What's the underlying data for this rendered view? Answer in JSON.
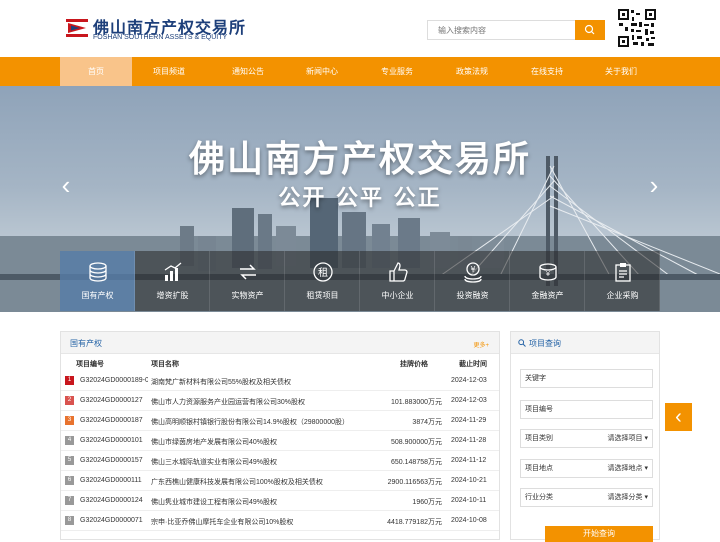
{
  "header": {
    "logo_cn": "佛山南方产权交易所",
    "logo_en": "FOSHAN SOUTHERN ASSETS & EQUITY",
    "search_placeholder": "输入搜索内容"
  },
  "nav": [
    "首页",
    "项目频道",
    "通知公告",
    "新闻中心",
    "专业服务",
    "政策法规",
    "在线支持",
    "关于我们"
  ],
  "banner": {
    "title": "佛山南方产权交易所",
    "subtitle": "公开 公平 公正"
  },
  "categories": [
    {
      "label": "国有产权",
      "icon": "coin-stack-icon"
    },
    {
      "label": "增资扩股",
      "icon": "bar-growth-icon"
    },
    {
      "label": "实物资产",
      "icon": "exchange-icon"
    },
    {
      "label": "租赁项目",
      "icon": "rent-icon"
    },
    {
      "label": "中小企业",
      "icon": "thumb-up-icon"
    },
    {
      "label": "投资融资",
      "icon": "yen-coins-icon"
    },
    {
      "label": "金融资产",
      "icon": "money-stack-icon"
    },
    {
      "label": "企业采购",
      "icon": "clipboard-icon"
    }
  ],
  "panel": {
    "title": "国有产权",
    "more": "更多+",
    "headers": [
      "项目编号",
      "项目名称",
      "挂牌价格",
      "截止时间"
    ],
    "rows": [
      {
        "n": "1",
        "code": "G32024GD0000189-0",
        "name": "湖南梵广新材料有限公司55%股权及相关债权",
        "price": "",
        "date": "2024-12-03"
      },
      {
        "n": "2",
        "code": "G32024GD0000127",
        "name": "佛山市人力资源服务产业园运营有限公司30%股权",
        "price": "101.883000万元",
        "date": "2024-12-03"
      },
      {
        "n": "3",
        "code": "G32024GD0000187",
        "name": "佛山高明顺银村镇银行股份有限公司14.9%股权（29800000股）",
        "price": "3874万元",
        "date": "2024-11-29"
      },
      {
        "n": "4",
        "code": "G32024GD0000101",
        "name": "佛山市绿茵房地产发展有限公司40%股权",
        "price": "508.900000万元",
        "date": "2024-11-28"
      },
      {
        "n": "5",
        "code": "G32024GD0000157",
        "name": "佛山三水城际轨道实业有限公司49%股权",
        "price": "650.148758万元",
        "date": "2024-11-12"
      },
      {
        "n": "6",
        "code": "G32024GD0000111",
        "name": "广东西樵山健康科技发展有限公司100%股权及相关债权",
        "price": "2900.116563万元",
        "date": "2024-10-21"
      },
      {
        "n": "7",
        "code": "G32024GD0000124",
        "name": "佛山隽业城市建设工程有限公司49%股权",
        "price": "1960万元",
        "date": "2024-10-11"
      },
      {
        "n": "8",
        "code": "G32024GD0000071",
        "name": "宗申·比亚乔佛山摩托车企业有限公司10%股权",
        "price": "4418.779182万元",
        "date": "2024-10-08"
      }
    ]
  },
  "query": {
    "title": "项目查询",
    "keyword": "关键字",
    "code": "项目编号",
    "category": "项目类别",
    "category_sel": "请选择项目",
    "location": "项目地点",
    "location_sel": "请选择地点",
    "industry": "行业分类",
    "industry_sel": "请选择分类",
    "button": "开始查询"
  },
  "colors": {
    "accent": "#f39200",
    "brand": "#1d3f7a",
    "link": "#2563a6"
  }
}
